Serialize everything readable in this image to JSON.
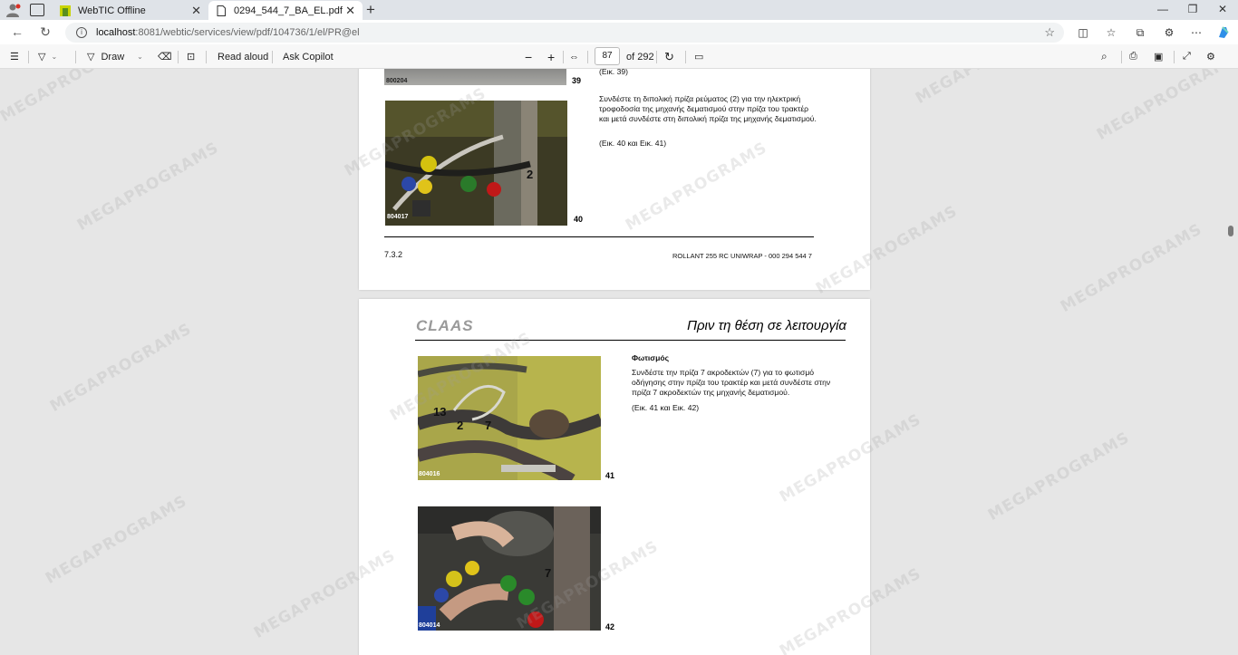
{
  "browser": {
    "tabs": [
      {
        "label": "WebTIC Offline",
        "active": false
      },
      {
        "label": "0294_544_7_BA_EL.pdf",
        "active": true
      }
    ],
    "url_host": "localhost",
    "url_path": ":8081/webtic/services/view/pdf/104736/1/el/PR@el"
  },
  "pdf_toolbar": {
    "draw_label": "Draw",
    "read_aloud_label": "Read aloud",
    "ask_copilot_label": "Ask Copilot",
    "page_current": "87",
    "page_total": "of 292"
  },
  "page1": {
    "top_caption": "(Εικ. 39)",
    "fig39_no": "39",
    "fig39_code": "800204",
    "paragraph": "Συνδέστε τη διπολική πρίζα ρεύματος (2) για την ηλεκτρική τροφοδοσία της μηχανής δεματισμού στην πρίζα του τρακτέρ και μετά συνδέστε στη διπολική πρίζα της μηχανής δεματισμού.",
    "ref": "(Εικ. 40 και Εικ. 41)",
    "fig40_no": "40",
    "fig40_code": "804017",
    "fig40_callout": "2",
    "footer_left": "7.3.2",
    "footer_right": "ROLLANT 255 RC UNIWRAP - 000 294 544 7"
  },
  "page2": {
    "logo": "CLAAS",
    "heading": "Πριν τη θέση σε λειτουργία",
    "section_title": "Φωτισμός",
    "paragraph": "Συνδέστε την πρίζα 7 ακροδεκτών (7) για το φωτισμό οδήγησης στην πρίζα του τρακτέρ και μετά συνδέστε στην πρίζα 7 ακροδεκτών της μηχανής δεματισμού.",
    "ref": "(Εικ. 41 και Εικ. 42)",
    "fig41_no": "41",
    "fig41_code": "804016",
    "fig41_callouts": [
      "13",
      "2",
      "7"
    ],
    "fig42_no": "42",
    "fig42_code": "804014",
    "fig42_callout": "7"
  },
  "watermark": "MEGAPROGRAMS",
  "colors": {
    "claas_logo": "#9a9a9a",
    "tab_strip": "#dfe3e8",
    "viewer_bg": "#e6e6e6"
  }
}
